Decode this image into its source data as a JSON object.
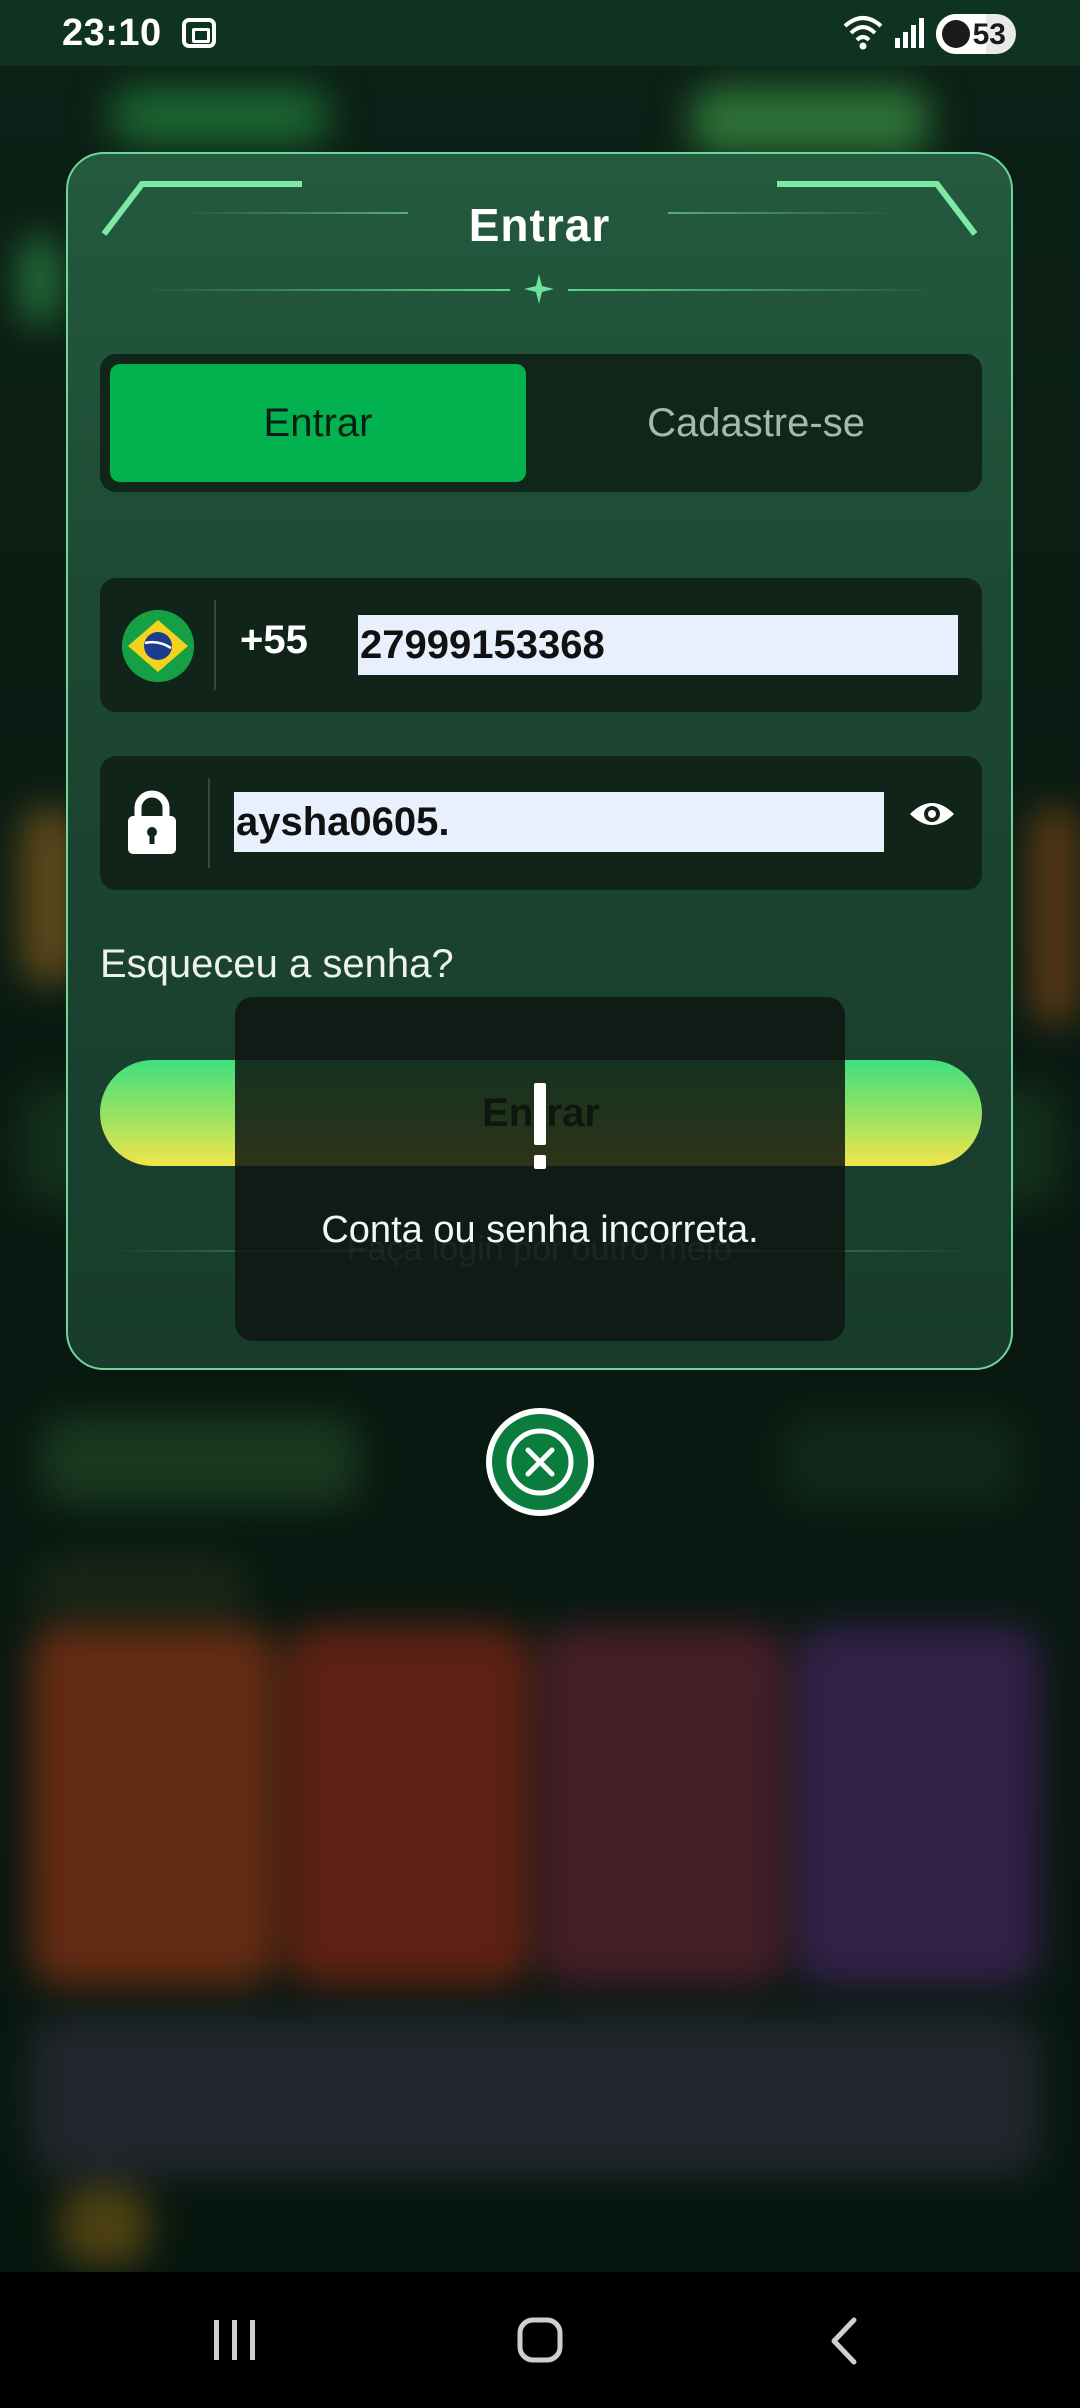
{
  "status_bar": {
    "time": "23:10",
    "battery": "53",
    "icons": [
      "screenshot-icon",
      "wifi-icon",
      "signal-icon",
      "battery-icon"
    ]
  },
  "modal": {
    "title": "Entrar",
    "tabs": [
      {
        "label": "Entrar",
        "active": true
      },
      {
        "label": "Cadastre-se",
        "active": false
      }
    ],
    "phone": {
      "country_flag": "brazil-flag-icon",
      "country_code": "+55",
      "value": "27999153368"
    },
    "password": {
      "value": "aysha0605.",
      "lock_icon": "lock-icon",
      "toggle_icon": "eye-icon"
    },
    "forgot_link": "Esqueceu a senha?",
    "submit_label": "Entrar",
    "other_login": "Faça login por outro meio"
  },
  "toast": {
    "icon": "exclamation-icon",
    "message": "Conta ou senha incorreta."
  },
  "close_button": {
    "icon": "close-icon"
  },
  "nav_bar": {
    "icons": [
      "recent-apps-icon",
      "home-icon",
      "back-icon"
    ]
  },
  "colors": {
    "accent": "#02b24f",
    "modal_bg": "#1c4632",
    "field_bg": "#112419",
    "input_fill": "#e8f0fe"
  }
}
